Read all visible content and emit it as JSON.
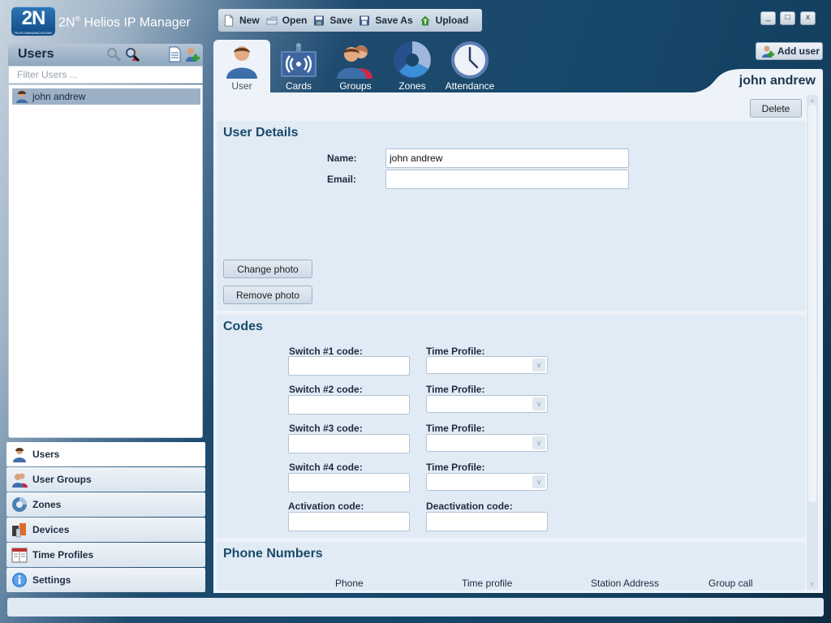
{
  "app": {
    "logo_text": "2N",
    "logo_subtext": "TELECOMMUNICATIONS",
    "title_prefix": "2N",
    "title_registered": "®",
    "title_suffix": " Helios IP Manager"
  },
  "window_controls": {
    "minimize": "_",
    "maximize": "□",
    "close": "x"
  },
  "toolbar": {
    "buttons": [
      {
        "label": "New",
        "icon": "new-document-icon"
      },
      {
        "label": "Open",
        "icon": "open-folder-icon"
      },
      {
        "label": "Save",
        "icon": "save-disk-icon"
      },
      {
        "label": "Save As",
        "icon": "save-as-disk-icon"
      },
      {
        "label": "Upload",
        "icon": "upload-house-icon"
      }
    ]
  },
  "sidebar": {
    "header_title": "Users",
    "filter_placeholder": "Filter Users ...",
    "filter_value": "",
    "users": [
      {
        "name": "john andrew",
        "selected": true
      }
    ],
    "nav": [
      {
        "label": "Users",
        "icon": "user-icon",
        "active": true
      },
      {
        "label": "User Groups",
        "icon": "user-group-icon",
        "active": false
      },
      {
        "label": "Zones",
        "icon": "zones-icon",
        "active": false
      },
      {
        "label": "Devices",
        "icon": "devices-icon",
        "active": false
      },
      {
        "label": "Time Profiles",
        "icon": "calendar-icon",
        "active": false
      },
      {
        "label": "Settings",
        "icon": "info-icon",
        "active": false
      }
    ]
  },
  "tabs": [
    {
      "label": "User",
      "icon": "user-icon",
      "active": true
    },
    {
      "label": "Cards",
      "icon": "card-reader-icon",
      "active": false
    },
    {
      "label": "Groups",
      "icon": "groups-icon",
      "active": false
    },
    {
      "label": "Zones",
      "icon": "zones-donut-icon",
      "active": false
    },
    {
      "label": "Attendance",
      "icon": "clock-icon",
      "active": false
    }
  ],
  "add_user_label": "Add user",
  "current_user": "john andrew",
  "delete_label": "Delete",
  "user_details": {
    "title": "User Details",
    "name_label": "Name:",
    "name_value": "john andrew",
    "email_label": "Email:",
    "email_value": "",
    "change_photo": "Change photo",
    "remove_photo": "Remove photo"
  },
  "codes": {
    "title": "Codes",
    "rows": [
      {
        "code_label": "Switch #1 code:",
        "code_value": "",
        "profile_label": "Time Profile:",
        "profile_value": ""
      },
      {
        "code_label": "Switch #2 code:",
        "code_value": "",
        "profile_label": "Time Profile:",
        "profile_value": ""
      },
      {
        "code_label": "Switch #3 code:",
        "code_value": "",
        "profile_label": "Time Profile:",
        "profile_value": ""
      },
      {
        "code_label": "Switch #4 code:",
        "code_value": "",
        "profile_label": "Time Profile:",
        "profile_value": ""
      }
    ],
    "activation_label": "Activation code:",
    "activation_value": "",
    "deactivation_label": "Deactivation code:",
    "deactivation_value": ""
  },
  "phone_numbers": {
    "title": "Phone Numbers",
    "columns": [
      "Phone",
      "Time profile",
      "Station Address",
      "Group call"
    ]
  },
  "status_text": ""
}
